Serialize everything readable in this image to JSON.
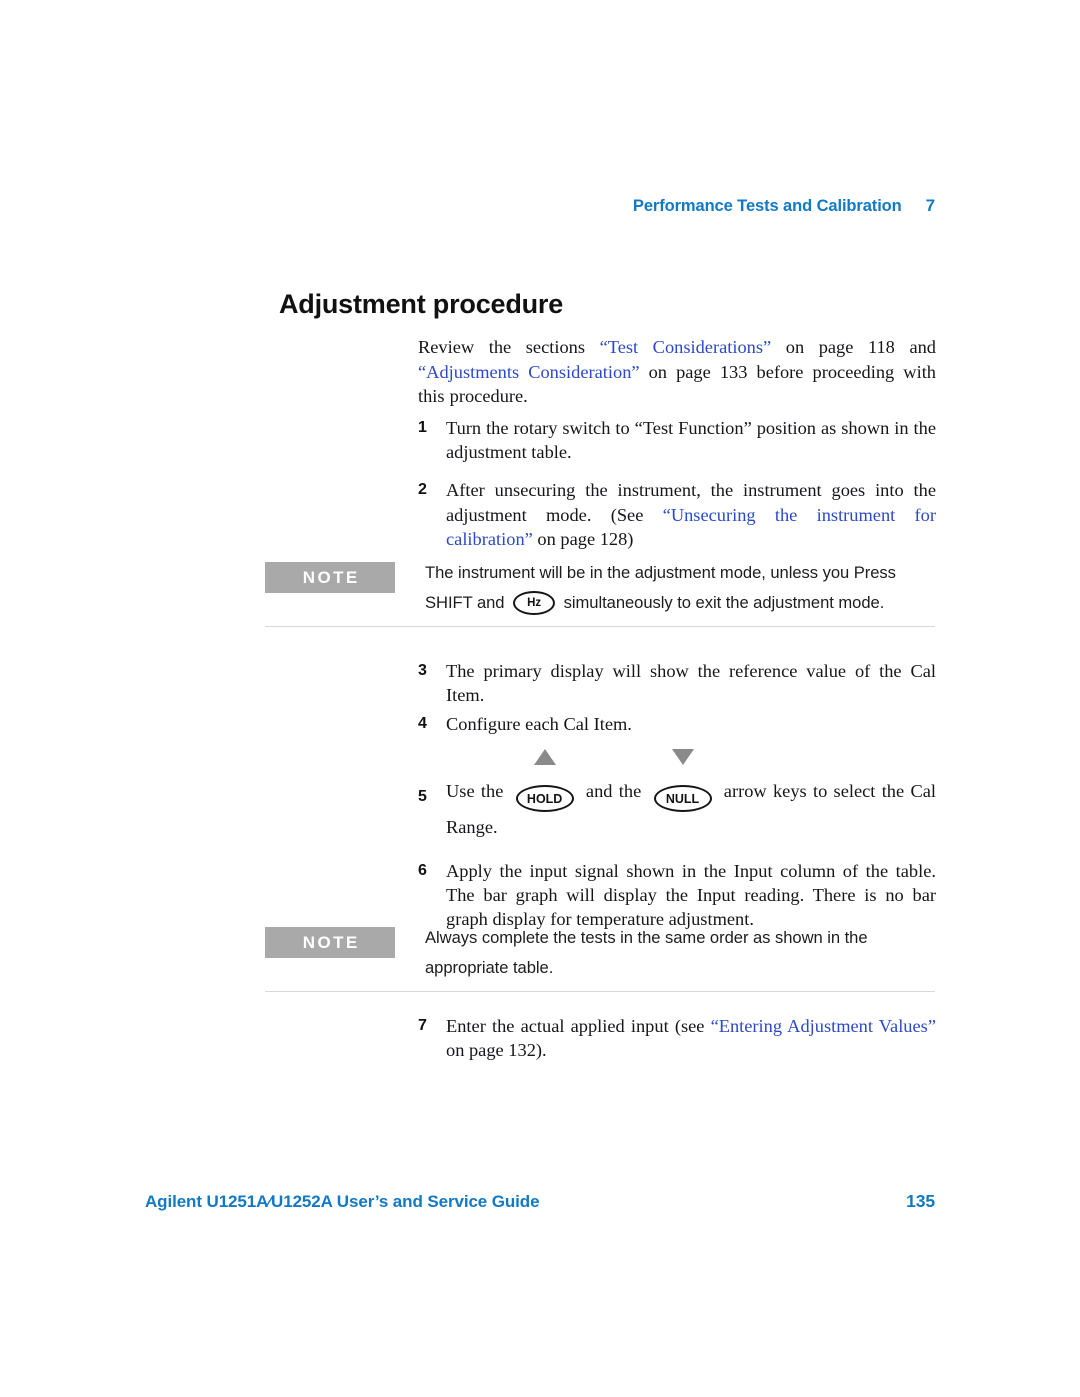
{
  "header": {
    "chapter_title": "Performance Tests and Calibration",
    "chapter_number": "7"
  },
  "section": {
    "heading": "Adjustment procedure"
  },
  "intro": {
    "text_1": "Review the sections ",
    "link_1": "“Test Considerations”",
    "text_2": " on page 118 and ",
    "link_2": "“Adjustments Consideration”",
    "text_3": " on page 133 before proceeding with this procedure."
  },
  "steps_group_1": [
    {
      "number": "1",
      "text": "Turn the rotary switch to “Test Function” position as shown in the adjustment table."
    },
    {
      "number": "2",
      "text_1": "After unsecuring the instrument, the instrument goes into the adjustment mode. (See ",
      "link": "“Unsecuring the instrument for calibration”",
      "text_2": " on page 128)"
    }
  ],
  "note_1": {
    "tag": "NOTE",
    "text_1": "The instrument will be in the adjustment mode, unless you Press SHIFT and ",
    "key_label": "Hz",
    "text_2": " simultaneously to exit the adjustment mode."
  },
  "steps_group_2": [
    {
      "number": "3",
      "text": "The primary display will show the reference value of the Cal Item."
    },
    {
      "number": "4",
      "text": "Configure each Cal Item."
    },
    {
      "number": "5",
      "text_1": "Use the ",
      "key_up_label": "HOLD",
      "text_2": " and the ",
      "key_down_label": "NULL",
      "text_3": " arrow keys to select the Cal Range."
    },
    {
      "number": "6",
      "text": "Apply the input signal shown in the Input column of the table. The bar graph will display the Input reading. There is no bar graph display for temperature adjustment."
    }
  ],
  "note_2": {
    "tag": "NOTE",
    "text": "Always complete the tests in the same order as shown in the appropriate table."
  },
  "steps_group_3": [
    {
      "number": "7",
      "text_1": "Enter the actual applied input (see ",
      "link": "“Entering Adjustment Values”",
      "text_2": " on page 132)."
    }
  ],
  "footer": {
    "guide_title": "Agilent U1251A∕U1252A User’s and Service Guide",
    "page_number": "135"
  },
  "colors": {
    "accent_blue": "#1279c4",
    "link_blue": "#2b49c9",
    "note_gray": "#a9a9a9",
    "rule_gray": "#d8d8d8"
  }
}
